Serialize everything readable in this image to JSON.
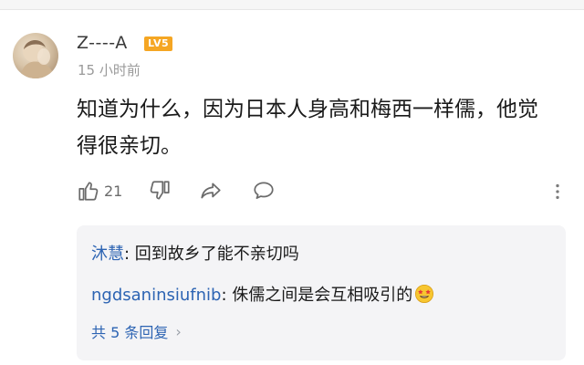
{
  "comment": {
    "username": "Z----A",
    "level_badge": "LV5",
    "time": "15 小时前",
    "text": "知道为什么，因为日本人身高和梅西一样儒，他觉得很亲切。",
    "likes": "21"
  },
  "replies": [
    {
      "author": "沐慧",
      "separator": ": ",
      "text": "回到故乡了能不亲切吗"
    },
    {
      "author": "ngdsaninsiufnib",
      "separator": ": ",
      "text": "侏儒之间是会互相吸引的"
    }
  ],
  "total_replies_label": "共 5 条回复",
  "icons": {
    "like": "thumbs-up-icon",
    "dislike": "thumbs-down-icon",
    "share": "share-icon",
    "reply": "comment-icon",
    "more": "more-vertical-icon"
  },
  "colors": {
    "accent_blue": "#2d64b3",
    "badge": "#f5a623",
    "reply_bg": "#f4f4f6"
  }
}
